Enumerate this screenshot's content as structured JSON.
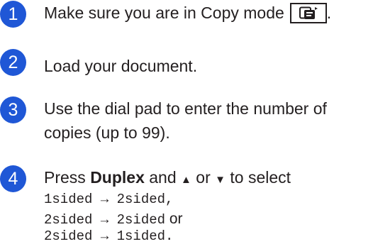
{
  "accent_color": "#1f57d6",
  "steps": [
    {
      "number": "1",
      "text": "Make sure you are in Copy mode",
      "key_icon": "copy-key-icon",
      "after_key": "."
    },
    {
      "number": "2",
      "text": "Load your document."
    },
    {
      "number": "3",
      "line1": "Use the dial pad to enter the number of",
      "line2": "copies (up to 99)."
    },
    {
      "number": "4",
      "press": "Press ",
      "key_name": "Duplex",
      "and_word": " and ",
      "up_arrow": "▲",
      "or_word": " or ",
      "down_arrow": "▼",
      "to_select": " to select",
      "options": [
        "1sided → 2sided,",
        "2sided → 2sided",
        "2sided → 1sided."
      ],
      "or_text": " or"
    }
  ]
}
